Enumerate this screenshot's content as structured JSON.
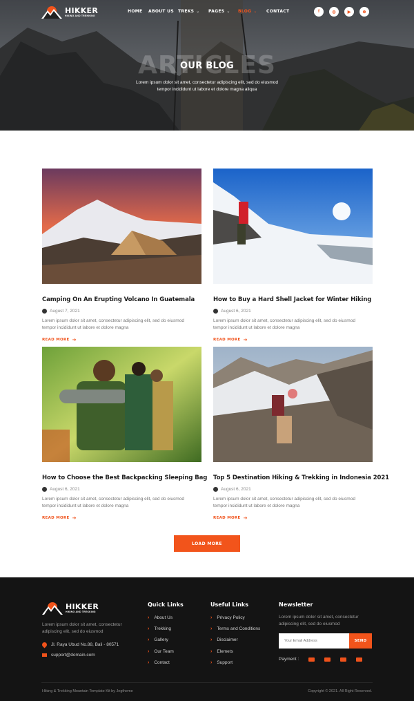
{
  "header": {
    "logo_name": "HIKKER",
    "logo_tagline": "HIKING AND TREKKING",
    "nav": [
      {
        "label": "HOME",
        "has_dropdown": false,
        "active": false
      },
      {
        "label": "ABOUT US",
        "has_dropdown": false,
        "active": false
      },
      {
        "label": "TREKS",
        "has_dropdown": true,
        "active": false
      },
      {
        "label": "PAGES",
        "has_dropdown": true,
        "active": false
      },
      {
        "label": "BLOG",
        "has_dropdown": true,
        "active": true
      },
      {
        "label": "CONTACT",
        "has_dropdown": false,
        "active": false
      }
    ],
    "social_icons": [
      "facebook-icon",
      "instagram-icon",
      "youtube-icon",
      "dribbble-icon"
    ]
  },
  "hero": {
    "watermark": "ARTICLES",
    "title": "OUR BLOG",
    "subtitle_line1": "Lorem ipsum dolor sit amet, consectetur adipiscing elit, sed do eiusmod",
    "subtitle_line2": "tempor incididunt ut labore et dolore magna aliqua"
  },
  "posts": [
    {
      "title": "Camping On An Erupting Volcano In Guatemala",
      "date": "August 7, 2021",
      "excerpt1": "Lorem ipsum dolor sit amet, consectetur adipiscing elit, sed do eiusmod",
      "excerpt2": "tempor incididunt ut labore et dolore magna",
      "read_more": "READ MORE"
    },
    {
      "title": "How to Buy a Hard Shell Jacket for Winter Hiking",
      "date": "August 6, 2021",
      "excerpt1": "Lorem ipsum dolor sit amet, consectetur adipiscing elit, sed do eiusmod",
      "excerpt2": "tempor incididunt ut labore et dolore magna",
      "read_more": "READ MORE"
    },
    {
      "title": "How to Choose the Best Backpacking Sleeping Bag",
      "date": "August 6, 2021",
      "excerpt1": "Lorem ipsum dolor sit amet, consectetur adipiscing elit, sed do eiusmod",
      "excerpt2": "tempor incididunt ut labore et dolore magna",
      "read_more": "READ MORE"
    },
    {
      "title": "Top 5 Destination Hiking & Trekking in Indonesia 2021",
      "date": "August 6, 2021",
      "excerpt1": "Lorem ipsum dolor sit amet, consectetur adipiscing elit, sed do eiusmod",
      "excerpt2": "tempor incididunt ut labore et dolore magna",
      "read_more": "READ MORE"
    }
  ],
  "load_more": "LOAD MORE",
  "footer": {
    "logo_name": "HIKKER",
    "logo_tagline": "HIKING AND TREKKING",
    "about1": "Lorem ipsum dolor sit amet, consectetur",
    "about2": "adipiscing elit, sed do eiusmod",
    "address": "Jl. Raya Ubud No.88, Bali - 80571",
    "email": "support@domain.com",
    "quick_links_title": "Quick Links",
    "quick_links": [
      "About Us",
      "Trekking",
      "Gallery",
      "Our Team",
      "Contact"
    ],
    "useful_links_title": "Useful Links",
    "useful_links": [
      "Privacy Policy",
      "Terms and Conditions",
      "Disclaimer",
      "Elemets",
      "Support"
    ],
    "newsletter_title": "Newsletter",
    "newsletter_text1": "Lorem ipsum dolor sit amet, consectetur",
    "newsletter_text2": "adipiscing elit, sed do eiusmod",
    "email_placeholder": "Your Email Address",
    "send": "SEND",
    "payment_label": "Payment :",
    "payment_icons": [
      "credit-card-icon",
      "bank-card-icon",
      "wallet-icon",
      "paypal-icon"
    ],
    "credit": "Hiking & Trekking Mountain Template Kit by Jegtheme",
    "copyright": "Copyright © 2021. All Right Reserved."
  },
  "colors": {
    "accent": "#f2541b",
    "footer_bg": "#141414"
  }
}
